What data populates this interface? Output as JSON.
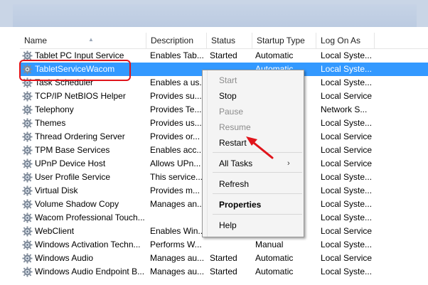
{
  "columns": [
    "Name",
    "Description",
    "Status",
    "Startup Type",
    "Log On As"
  ],
  "rows": [
    {
      "name": "Tablet PC Input Service",
      "desc": "Enables Tab...",
      "status": "Started",
      "startup": "Automatic",
      "logon": "Local Syste..."
    },
    {
      "name": "TabletServiceWacom",
      "desc": "",
      "status": "",
      "startup": "Automatic",
      "logon": "Local Syste...",
      "selected": true
    },
    {
      "name": "Task Scheduler",
      "desc": "Enables a us...",
      "status": "",
      "startup": "",
      "logon": "Local Syste..."
    },
    {
      "name": "TCP/IP NetBIOS Helper",
      "desc": "Provides su...",
      "status": "",
      "startup": "",
      "logon": "Local Service"
    },
    {
      "name": "Telephony",
      "desc": "Provides Te...",
      "status": "",
      "startup": "",
      "logon": "Network S..."
    },
    {
      "name": "Themes",
      "desc": "Provides us...",
      "status": "",
      "startup": "",
      "logon": "Local Syste..."
    },
    {
      "name": "Thread Ordering Server",
      "desc": "Provides or...",
      "status": "",
      "startup": "",
      "logon": "Local Service"
    },
    {
      "name": "TPM Base Services",
      "desc": "Enables acc...",
      "status": "",
      "startup": "",
      "logon": "Local Service"
    },
    {
      "name": "UPnP Device Host",
      "desc": "Allows UPn...",
      "status": "",
      "startup": "",
      "logon": "Local Service"
    },
    {
      "name": "User Profile Service",
      "desc": "This service...",
      "status": "",
      "startup": "",
      "logon": "Local Syste..."
    },
    {
      "name": "Virtual Disk",
      "desc": "Provides m...",
      "status": "",
      "startup": "",
      "logon": "Local Syste..."
    },
    {
      "name": "Volume Shadow Copy",
      "desc": "Manages an...",
      "status": "",
      "startup": "",
      "logon": "Local Syste..."
    },
    {
      "name": "Wacom Professional Touch...",
      "desc": "",
      "status": "",
      "startup": "",
      "logon": "Local Syste..."
    },
    {
      "name": "WebClient",
      "desc": "Enables Win...",
      "status": "",
      "startup": "",
      "logon": "Local Service"
    },
    {
      "name": "Windows Activation Techn...",
      "desc": "Performs W...",
      "status": "",
      "startup": "Manual",
      "logon": "Local Syste..."
    },
    {
      "name": "Windows Audio",
      "desc": "Manages au...",
      "status": "Started",
      "startup": "Automatic",
      "logon": "Local Service"
    },
    {
      "name": "Windows Audio Endpoint B...",
      "desc": "Manages au...",
      "status": "Started",
      "startup": "Automatic",
      "logon": "Local Syste..."
    }
  ],
  "menu": {
    "start": "Start",
    "stop": "Stop",
    "pause": "Pause",
    "resume": "Resume",
    "restart": "Restart",
    "all_tasks": "All Tasks",
    "refresh": "Refresh",
    "properties": "Properties",
    "help": "Help"
  },
  "colors": {
    "selection": "#3399ff",
    "highlight": "#e0141b",
    "menu_bg": "#f4f4f4"
  },
  "icons": {
    "service_icon": "gear-icon",
    "submenu": "chevron-right-icon",
    "annotation": "arrow-annotation"
  }
}
